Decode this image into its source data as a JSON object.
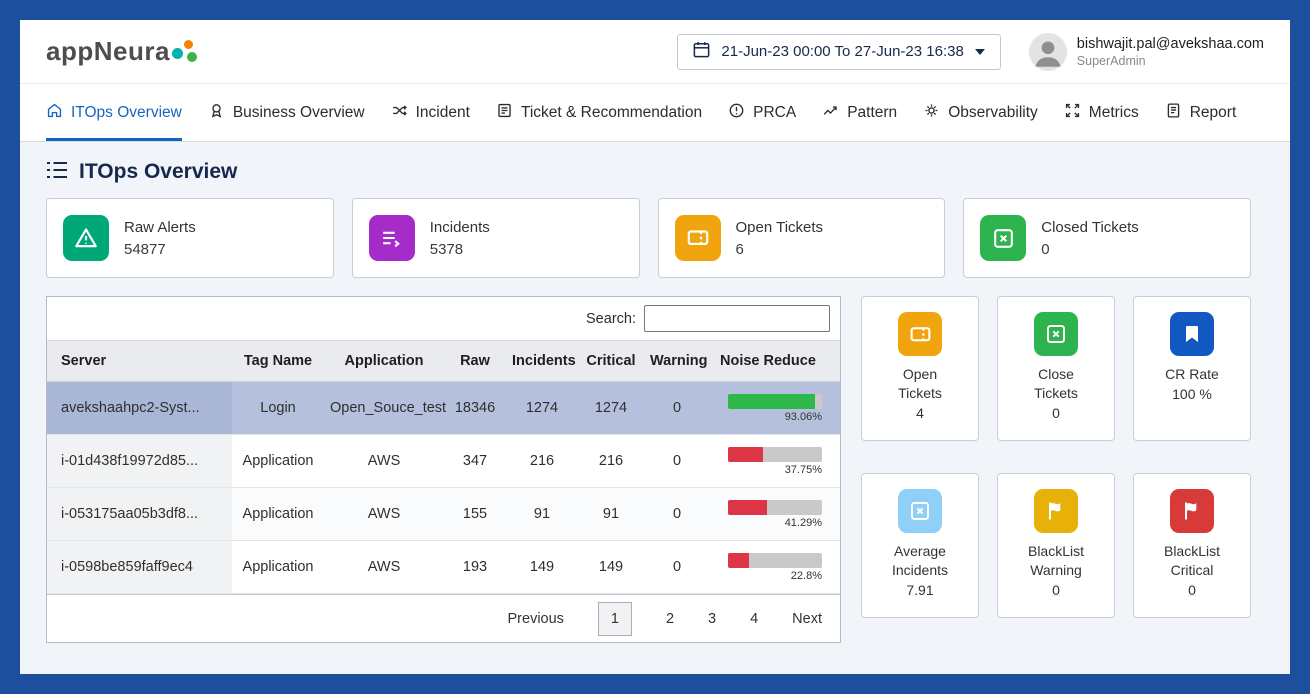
{
  "header": {
    "logo_text": "appNeura",
    "date_range": "21-Jun-23 00:00 To 27-Jun-23 16:38",
    "user_email": "bishwajit.pal@avekshaa.com",
    "user_role": "SuperAdmin"
  },
  "nav": {
    "tabs": [
      {
        "label": "ITOps Overview",
        "active": true
      },
      {
        "label": "Business Overview",
        "active": false
      },
      {
        "label": "Incident",
        "active": false
      },
      {
        "label": "Ticket & Recommendation",
        "active": false
      },
      {
        "label": "PRCA",
        "active": false
      },
      {
        "label": "Pattern",
        "active": false
      },
      {
        "label": "Observability",
        "active": false
      },
      {
        "label": "Metrics",
        "active": false
      },
      {
        "label": "Report",
        "active": false
      }
    ]
  },
  "page": {
    "title": "ITOps Overview"
  },
  "stat_cards": [
    {
      "label": "Raw Alerts",
      "value": "54877",
      "color": "#00a878",
      "icon": "alert-triangle-icon"
    },
    {
      "label": "Incidents",
      "value": "5378",
      "color": "#a62cc9",
      "icon": "incidents-list-icon"
    },
    {
      "label": "Open Tickets",
      "value": "6",
      "color": "#f0a50e",
      "icon": "ticket-icon"
    },
    {
      "label": "Closed Tickets",
      "value": "0",
      "color": "#2eb44f",
      "icon": "closed-square-icon"
    }
  ],
  "table": {
    "search_label": "Search:",
    "search_value": "",
    "columns": [
      "Server",
      "Tag Name",
      "Application",
      "Raw",
      "Incidents",
      "Critical",
      "Warning",
      "Noise Reduce"
    ],
    "rows": [
      {
        "server": "avekshaahpc2-Syst...",
        "tag_name": "Login",
        "application": "Open_Souce_test",
        "raw": "18346",
        "incidents": "1274",
        "critical": "1274",
        "warning": "0",
        "noise_pct": 93.06,
        "noise_label": "93.06%",
        "bar_color": "#2eb84c",
        "selected": true
      },
      {
        "server": "i-01d438f19972d85...",
        "tag_name": "Application",
        "application": "AWS",
        "raw": "347",
        "incidents": "216",
        "critical": "216",
        "warning": "0",
        "noise_pct": 37.75,
        "noise_label": "37.75%",
        "bar_color": "#dc3545",
        "selected": false
      },
      {
        "server": "i-053175aa05b3df8...",
        "tag_name": "Application",
        "application": "AWS",
        "raw": "155",
        "incidents": "91",
        "critical": "91",
        "warning": "0",
        "noise_pct": 41.29,
        "noise_label": "41.29%",
        "bar_color": "#dc3545",
        "selected": false
      },
      {
        "server": "i-0598be859faff9ec4",
        "tag_name": "Application",
        "application": "AWS",
        "raw": "193",
        "incidents": "149",
        "critical": "149",
        "warning": "0",
        "noise_pct": 22.8,
        "noise_label": "22.8%",
        "bar_color": "#dc3545",
        "selected": false
      }
    ],
    "pagination": {
      "previous_label": "Previous",
      "pages": [
        "1",
        "2",
        "3",
        "4"
      ],
      "active_page": "1",
      "next_label": "Next"
    }
  },
  "side_cards": [
    {
      "label": "Open Tickets",
      "value": "4",
      "color": "#f0a50e",
      "icon": "ticket-icon"
    },
    {
      "label": "Close Tickets",
      "value": "0",
      "color": "#2eb44f",
      "icon": "closed-square-icon"
    },
    {
      "label": "CR Rate",
      "value": "100 %",
      "color": "#1159c0",
      "icon": "bookmark-icon"
    },
    {
      "label": "Average Incidents",
      "value": "7.91",
      "color": "#8fd0f8",
      "icon": "square-x-icon"
    },
    {
      "label": "BlackList Warning",
      "value": "0",
      "color": "#e7b10a",
      "icon": "flag-icon"
    },
    {
      "label": "BlackList Critical",
      "value": "0",
      "color": "#d83a3a",
      "icon": "flag-icon"
    }
  ],
  "colors": {
    "frame_border": "#1d4f9e",
    "accent_blue": "#1565c0",
    "page_bg": "#f1f4f9",
    "selected_row": "#b5c0dd",
    "logo_dot_teal": "#00b3ad",
    "logo_dot_orange": "#f5820b",
    "logo_dot_green": "#3cb44a"
  }
}
